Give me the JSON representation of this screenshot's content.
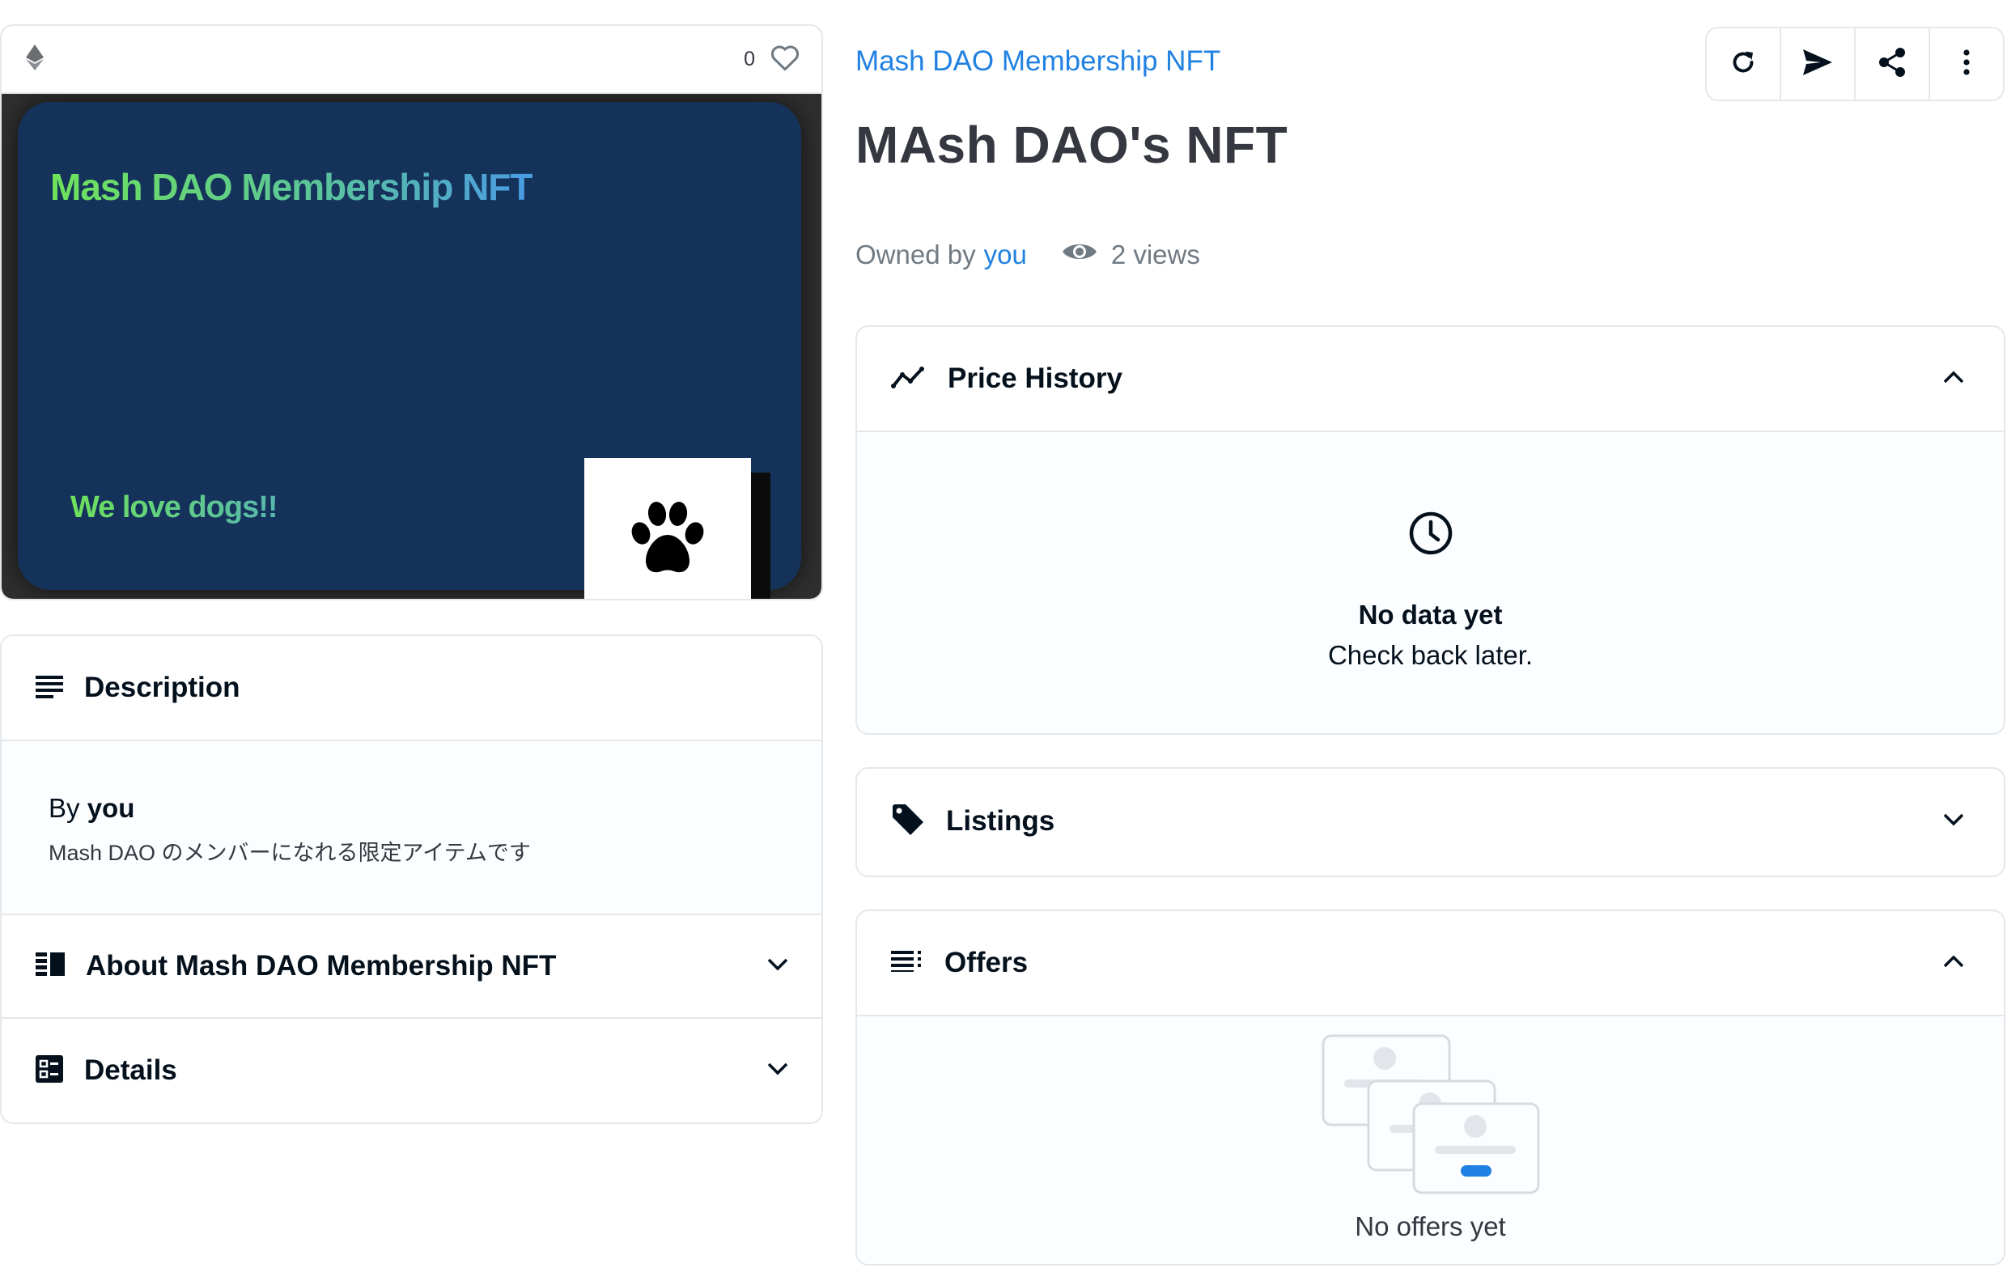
{
  "media": {
    "favorite_count": "0",
    "nft_title": "Mash DAO Membership NFT",
    "nft_tagline": "We love dogs!!"
  },
  "description": {
    "header": "Description",
    "by_prefix": "By",
    "by_user": "you",
    "text": "Mash DAO のメンバーになれる限定アイテムです"
  },
  "about": {
    "header": "About Mash DAO Membership NFT"
  },
  "details": {
    "header": "Details"
  },
  "item": {
    "collection": "Mash DAO Membership NFT",
    "name": "MAsh DAO's NFT",
    "owned_by_label": "Owned by",
    "owner": "you",
    "views": "2 views"
  },
  "price_history": {
    "header": "Price History",
    "empty_title": "No data yet",
    "empty_sub": "Check back later."
  },
  "listings": {
    "header": "Listings"
  },
  "offers": {
    "header": "Offers",
    "empty": "No offers yet"
  },
  "colors": {
    "accent": "#2081e2",
    "nft_background": "#15335a",
    "border": "#e5e8eb"
  }
}
